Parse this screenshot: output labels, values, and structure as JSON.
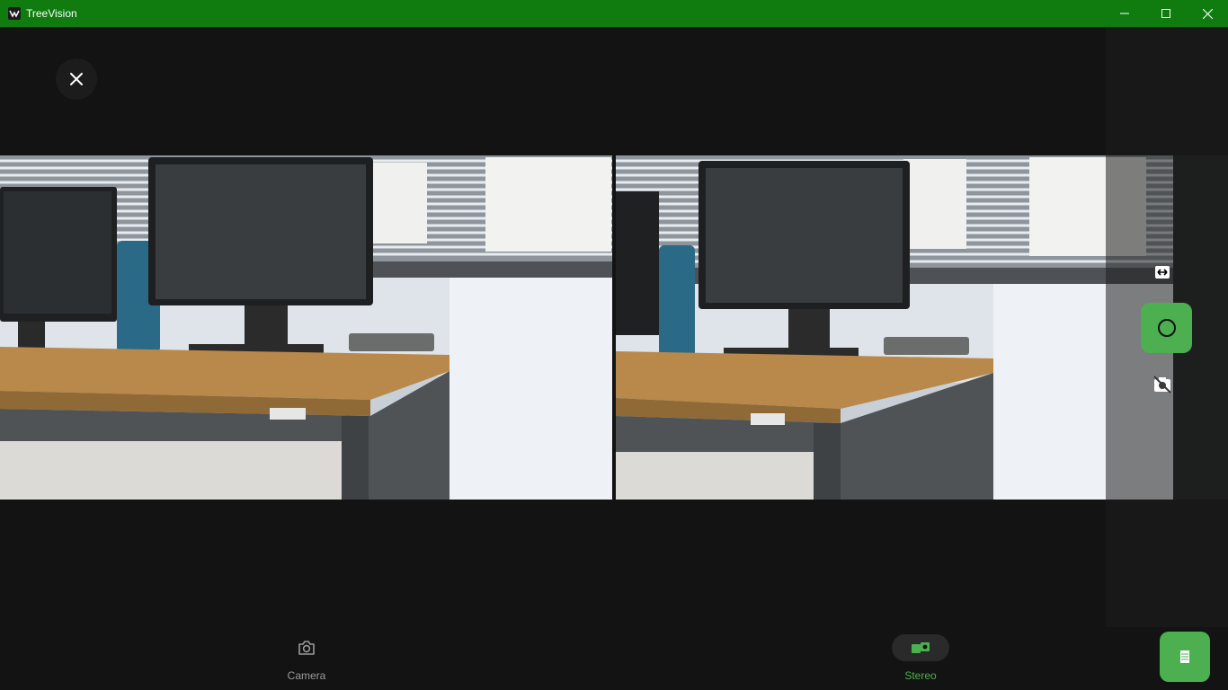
{
  "window": {
    "title": "TreeVision",
    "accent": "#107c10"
  },
  "toolbar": {
    "close_icon": "close-icon"
  },
  "previews": {
    "left_label": "left-camera-preview",
    "right_label": "right-camera-preview"
  },
  "side_controls": {
    "swap_icon": "swap-horizontal-icon",
    "capture_icon": "capture-circle-icon",
    "camera_off_icon": "camera-off-icon",
    "capture_color": "#4caf50"
  },
  "nav": {
    "items": [
      {
        "label": "Camera",
        "icon": "camera-icon",
        "selected": false
      },
      {
        "label": "Stereo",
        "icon": "stereo-camera-icon",
        "selected": true
      }
    ],
    "selected_color": "#4caf50"
  },
  "fab": {
    "icon": "list-icon"
  }
}
